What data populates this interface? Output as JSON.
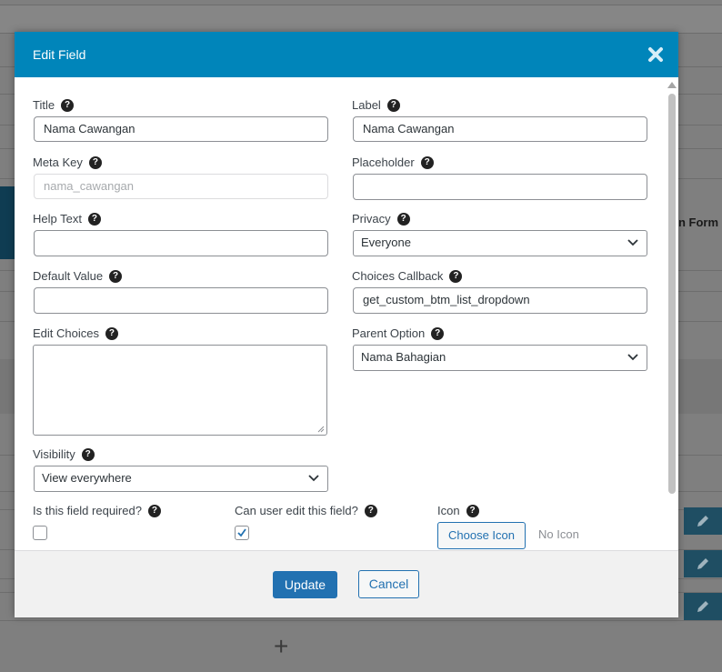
{
  "background": {
    "partial_text": "n Form",
    "edit_buttons": [
      "pencil-icon",
      "pencil-icon",
      "pencil-icon"
    ],
    "add_icon": "+"
  },
  "modal": {
    "title": "Edit Field",
    "close_icon": "close-icon"
  },
  "fields": {
    "title": {
      "label": "Title",
      "value": "Nama Cawangan"
    },
    "label": {
      "label": "Label",
      "value": "Nama Cawangan"
    },
    "meta_key": {
      "label": "Meta Key",
      "placeholder": "nama_cawangan"
    },
    "placeholder": {
      "label": "Placeholder",
      "value": ""
    },
    "help_text": {
      "label": "Help Text",
      "value": ""
    },
    "privacy": {
      "label": "Privacy",
      "selected": "Everyone"
    },
    "default_value": {
      "label": "Default Value",
      "value": ""
    },
    "choices_callback": {
      "label": "Choices Callback",
      "value": "get_custom_btm_list_dropdown"
    },
    "edit_choices": {
      "label": "Edit Choices",
      "value": ""
    },
    "parent_option": {
      "label": "Parent Option",
      "selected": "Nama Bahagian"
    },
    "visibility": {
      "label": "Visibility",
      "selected": "View everywhere"
    },
    "required": {
      "label": "Is this field required?",
      "checked": false
    },
    "editable": {
      "label": "Can user edit this field?",
      "checked": true
    },
    "icon": {
      "label": "Icon",
      "button": "Choose Icon",
      "status": "No Icon"
    }
  },
  "help_glyph": "?",
  "footer": {
    "update": "Update",
    "cancel": "Cancel"
  },
  "colors": {
    "header": "#0085ba",
    "primary": "#2271b1"
  }
}
